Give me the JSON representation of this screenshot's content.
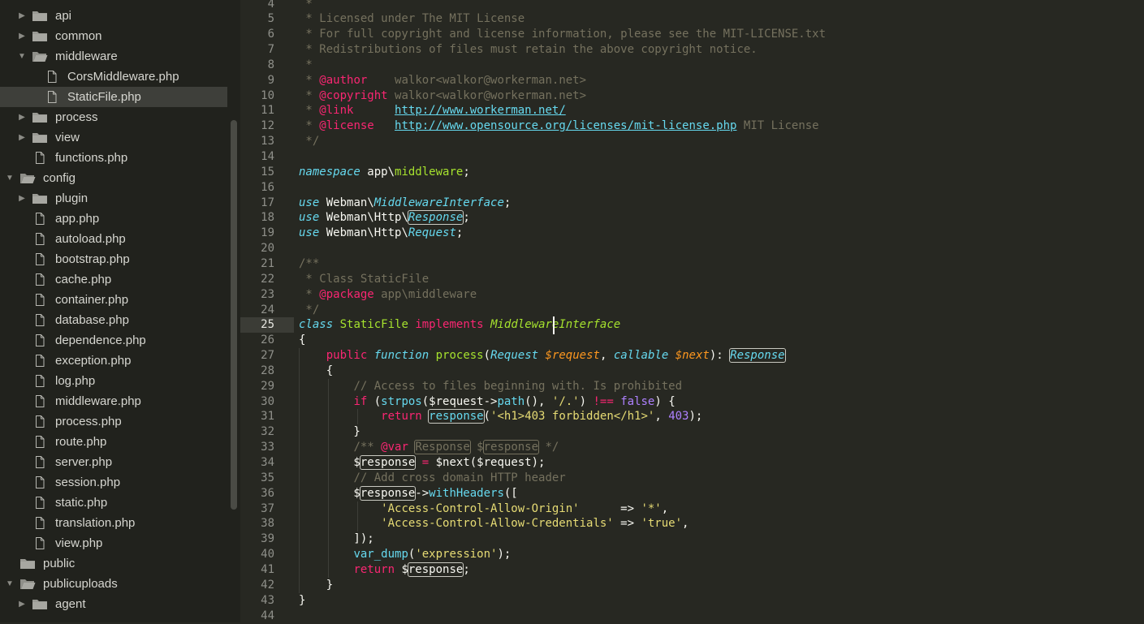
{
  "sidebar": {
    "items": [
      {
        "label": "api",
        "type": "folder",
        "state": "collapsed",
        "depth": 1
      },
      {
        "label": "common",
        "type": "folder",
        "state": "collapsed",
        "depth": 1
      },
      {
        "label": "middleware",
        "type": "folder",
        "state": "expanded",
        "depth": 1
      },
      {
        "label": "CorsMiddleware.php",
        "type": "file",
        "depth": 2
      },
      {
        "label": "StaticFile.php",
        "type": "file",
        "depth": 2,
        "selected": true
      },
      {
        "label": "process",
        "type": "folder",
        "state": "collapsed",
        "depth": 1
      },
      {
        "label": "view",
        "type": "folder",
        "state": "collapsed",
        "depth": 1
      },
      {
        "label": "functions.php",
        "type": "file",
        "depth": 1
      },
      {
        "label": "config",
        "type": "folder",
        "state": "expanded",
        "depth": 0
      },
      {
        "label": "plugin",
        "type": "folder",
        "state": "collapsed",
        "depth": 1
      },
      {
        "label": "app.php",
        "type": "file",
        "depth": 1
      },
      {
        "label": "autoload.php",
        "type": "file",
        "depth": 1
      },
      {
        "label": "bootstrap.php",
        "type": "file",
        "depth": 1
      },
      {
        "label": "cache.php",
        "type": "file",
        "depth": 1
      },
      {
        "label": "container.php",
        "type": "file",
        "depth": 1
      },
      {
        "label": "database.php",
        "type": "file",
        "depth": 1
      },
      {
        "label": "dependence.php",
        "type": "file",
        "depth": 1
      },
      {
        "label": "exception.php",
        "type": "file",
        "depth": 1
      },
      {
        "label": "log.php",
        "type": "file",
        "depth": 1
      },
      {
        "label": "middleware.php",
        "type": "file",
        "depth": 1
      },
      {
        "label": "process.php",
        "type": "file",
        "depth": 1
      },
      {
        "label": "route.php",
        "type": "file",
        "depth": 1
      },
      {
        "label": "server.php",
        "type": "file",
        "depth": 1
      },
      {
        "label": "session.php",
        "type": "file",
        "depth": 1
      },
      {
        "label": "static.php",
        "type": "file",
        "depth": 1
      },
      {
        "label": "translation.php",
        "type": "file",
        "depth": 1
      },
      {
        "label": "view.php",
        "type": "file",
        "depth": 1
      },
      {
        "label": "public",
        "type": "folder",
        "state": "none",
        "depth": 0
      },
      {
        "label": "publicuploads",
        "type": "folder",
        "state": "expanded",
        "depth": 0
      },
      {
        "label": "agent",
        "type": "folder",
        "state": "collapsed",
        "depth": 1
      }
    ]
  },
  "editor": {
    "current_line": "25",
    "lines": [
      {
        "n": "4",
        "segs": [
          {
            "t": " *",
            "c": "cm"
          }
        ]
      },
      {
        "n": "5",
        "segs": [
          {
            "t": " * Licensed under The MIT License",
            "c": "cm"
          }
        ]
      },
      {
        "n": "6",
        "segs": [
          {
            "t": " * For full copyright and license information, please see the MIT-LICENSE.txt",
            "c": "cm"
          }
        ]
      },
      {
        "n": "7",
        "segs": [
          {
            "t": " * Redistributions of files must retain the above copyright notice.",
            "c": "cm"
          }
        ]
      },
      {
        "n": "8",
        "segs": [
          {
            "t": " *",
            "c": "cm"
          }
        ]
      },
      {
        "n": "9",
        "segs": [
          {
            "t": " * ",
            "c": "cm"
          },
          {
            "t": "@author",
            "c": "tag"
          },
          {
            "t": "    walkor<walkor@workerman.net>",
            "c": "cm"
          }
        ]
      },
      {
        "n": "10",
        "segs": [
          {
            "t": " * ",
            "c": "cm"
          },
          {
            "t": "@copyright",
            "c": "tag"
          },
          {
            "t": " walkor<walkor@workerman.net>",
            "c": "cm"
          }
        ]
      },
      {
        "n": "11",
        "segs": [
          {
            "t": " * ",
            "c": "cm"
          },
          {
            "t": "@link",
            "c": "tag"
          },
          {
            "t": "      ",
            "c": "cm"
          },
          {
            "t": "http://www.workerman.net/",
            "c": "url"
          }
        ]
      },
      {
        "n": "12",
        "segs": [
          {
            "t": " * ",
            "c": "cm"
          },
          {
            "t": "@license",
            "c": "tag"
          },
          {
            "t": "   ",
            "c": "cm"
          },
          {
            "t": "http://www.opensource.org/licenses/mit-license.php",
            "c": "url"
          },
          {
            "t": " MIT License",
            "c": "cm"
          }
        ]
      },
      {
        "n": "13",
        "segs": [
          {
            "t": " */",
            "c": "cm"
          }
        ]
      },
      {
        "n": "14",
        "segs": []
      },
      {
        "n": "15",
        "segs": [
          {
            "t": "namespace",
            "c": "sk"
          },
          {
            "t": " app\\",
            "c": ""
          },
          {
            "t": "middleware",
            "c": "cls"
          },
          {
            "t": ";",
            "c": ""
          }
        ]
      },
      {
        "n": "16",
        "segs": []
      },
      {
        "n": "17",
        "segs": [
          {
            "t": "use",
            "c": "sk"
          },
          {
            "t": " Webman\\",
            "c": ""
          },
          {
            "t": "MiddlewareInterface",
            "c": "ty"
          },
          {
            "t": ";",
            "c": ""
          }
        ]
      },
      {
        "n": "18",
        "segs": [
          {
            "t": "use",
            "c": "sk"
          },
          {
            "t": " Webman\\Http\\",
            "c": ""
          },
          {
            "t": "Response",
            "c": "ty box"
          },
          {
            "t": ";",
            "c": ""
          }
        ]
      },
      {
        "n": "19",
        "segs": [
          {
            "t": "use",
            "c": "sk"
          },
          {
            "t": " Webman\\Http\\",
            "c": ""
          },
          {
            "t": "Request",
            "c": "ty"
          },
          {
            "t": ";",
            "c": ""
          }
        ]
      },
      {
        "n": "20",
        "segs": []
      },
      {
        "n": "21",
        "segs": [
          {
            "t": "/**",
            "c": "cm"
          }
        ]
      },
      {
        "n": "22",
        "segs": [
          {
            "t": " * Class StaticFile",
            "c": "cm"
          }
        ]
      },
      {
        "n": "23",
        "segs": [
          {
            "t": " * ",
            "c": "cm"
          },
          {
            "t": "@package",
            "c": "tag"
          },
          {
            "t": " app\\middleware",
            "c": "cm"
          }
        ]
      },
      {
        "n": "24",
        "segs": [
          {
            "t": " */",
            "c": "cm"
          }
        ]
      },
      {
        "n": "25",
        "segs": [
          {
            "t": "class",
            "c": "sk"
          },
          {
            "t": " ",
            "c": ""
          },
          {
            "t": "StaticFile",
            "c": "cls"
          },
          {
            "t": " ",
            "c": ""
          },
          {
            "t": "implements",
            "c": "kw"
          },
          {
            "t": " ",
            "c": ""
          },
          {
            "t": "MiddlewareInterface",
            "c": "ifc"
          }
        ]
      },
      {
        "n": "26",
        "segs": [
          {
            "t": "{",
            "c": ""
          }
        ]
      },
      {
        "n": "27",
        "segs": [
          {
            "t": "    ",
            "c": ""
          },
          {
            "t": "public",
            "c": "kw"
          },
          {
            "t": " ",
            "c": ""
          },
          {
            "t": "function",
            "c": "sk"
          },
          {
            "t": " ",
            "c": ""
          },
          {
            "t": "process",
            "c": "fn"
          },
          {
            "t": "(",
            "c": ""
          },
          {
            "t": "Request",
            "c": "ty"
          },
          {
            "t": " ",
            "c": ""
          },
          {
            "t": "$request",
            "c": "va"
          },
          {
            "t": ", ",
            "c": ""
          },
          {
            "t": "callable",
            "c": "ty"
          },
          {
            "t": " ",
            "c": ""
          },
          {
            "t": "$next",
            "c": "va"
          },
          {
            "t": "): ",
            "c": ""
          },
          {
            "t": "Response",
            "c": "ty box"
          }
        ]
      },
      {
        "n": "28",
        "segs": [
          {
            "t": "    {",
            "c": ""
          }
        ]
      },
      {
        "n": "29",
        "segs": [
          {
            "t": "        ",
            "c": ""
          },
          {
            "t": "// Access to files beginning with. Is prohibited",
            "c": "cm"
          }
        ]
      },
      {
        "n": "30",
        "segs": [
          {
            "t": "        ",
            "c": ""
          },
          {
            "t": "if",
            "c": "kw"
          },
          {
            "t": " (",
            "c": ""
          },
          {
            "t": "strpos",
            "c": "bi"
          },
          {
            "t": "($request->",
            "c": ""
          },
          {
            "t": "path",
            "c": "bi"
          },
          {
            "t": "(), ",
            "c": ""
          },
          {
            "t": "'/.'",
            "c": "st"
          },
          {
            "t": ") ",
            "c": ""
          },
          {
            "t": "!==",
            "c": "kw"
          },
          {
            "t": " ",
            "c": ""
          },
          {
            "t": "false",
            "c": "nu"
          },
          {
            "t": ") {",
            "c": ""
          }
        ]
      },
      {
        "n": "31",
        "segs": [
          {
            "t": "            ",
            "c": ""
          },
          {
            "t": "return",
            "c": "kw"
          },
          {
            "t": " ",
            "c": ""
          },
          {
            "t": "response",
            "c": "bi box"
          },
          {
            "t": "(",
            "c": ""
          },
          {
            "t": "'<h1>403 forbidden</h1>'",
            "c": "st"
          },
          {
            "t": ", ",
            "c": ""
          },
          {
            "t": "403",
            "c": "nu"
          },
          {
            "t": ");",
            "c": ""
          }
        ]
      },
      {
        "n": "32",
        "segs": [
          {
            "t": "        }",
            "c": ""
          }
        ]
      },
      {
        "n": "33",
        "segs": [
          {
            "t": "        ",
            "c": ""
          },
          {
            "t": "/** ",
            "c": "cm"
          },
          {
            "t": "@var",
            "c": "tag"
          },
          {
            "t": " ",
            "c": "cm"
          },
          {
            "t": "Response",
            "c": "cm boxd"
          },
          {
            "t": " $",
            "c": "cm"
          },
          {
            "t": "response",
            "c": "cm boxd"
          },
          {
            "t": " */",
            "c": "cm"
          }
        ]
      },
      {
        "n": "34",
        "segs": [
          {
            "t": "        $",
            "c": ""
          },
          {
            "t": "response",
            "c": "box"
          },
          {
            "t": " ",
            "c": ""
          },
          {
            "t": "=",
            "c": "kw"
          },
          {
            "t": " $next($request);",
            "c": ""
          }
        ]
      },
      {
        "n": "35",
        "segs": [
          {
            "t": "        ",
            "c": ""
          },
          {
            "t": "// Add cross domain HTTP header",
            "c": "cm"
          }
        ]
      },
      {
        "n": "36",
        "segs": [
          {
            "t": "        $",
            "c": ""
          },
          {
            "t": "response",
            "c": "box"
          },
          {
            "t": "->",
            "c": ""
          },
          {
            "t": "withHeaders",
            "c": "bi"
          },
          {
            "t": "([",
            "c": ""
          }
        ]
      },
      {
        "n": "37",
        "segs": [
          {
            "t": "            ",
            "c": ""
          },
          {
            "t": "'Access-Control-Allow-Origin'",
            "c": "st"
          },
          {
            "t": "      => ",
            "c": ""
          },
          {
            "t": "'*'",
            "c": "st"
          },
          {
            "t": ",",
            "c": ""
          }
        ]
      },
      {
        "n": "38",
        "segs": [
          {
            "t": "            ",
            "c": ""
          },
          {
            "t": "'Access-Control-Allow-Credentials'",
            "c": "st"
          },
          {
            "t": " => ",
            "c": ""
          },
          {
            "t": "'true'",
            "c": "st"
          },
          {
            "t": ",",
            "c": ""
          }
        ]
      },
      {
        "n": "39",
        "segs": [
          {
            "t": "        ]);",
            "c": ""
          }
        ]
      },
      {
        "n": "40",
        "segs": [
          {
            "t": "        ",
            "c": ""
          },
          {
            "t": "var_dump",
            "c": "bi"
          },
          {
            "t": "(",
            "c": ""
          },
          {
            "t": "'expression'",
            "c": "st"
          },
          {
            "t": ");",
            "c": ""
          }
        ]
      },
      {
        "n": "41",
        "segs": [
          {
            "t": "        ",
            "c": ""
          },
          {
            "t": "return",
            "c": "kw"
          },
          {
            "t": " $",
            "c": ""
          },
          {
            "t": "response",
            "c": "box"
          },
          {
            "t": ";",
            "c": ""
          }
        ]
      },
      {
        "n": "42",
        "segs": [
          {
            "t": "    }",
            "c": ""
          }
        ]
      },
      {
        "n": "43",
        "segs": [
          {
            "t": "}",
            "c": ""
          }
        ]
      },
      {
        "n": "44",
        "segs": []
      }
    ]
  },
  "colors": {
    "editor_bg": "#272822",
    "sidebar_bg": "#21221d",
    "selected_row": "#3e3f3a"
  },
  "icons": {
    "folder": "folder-icon",
    "folder_open": "folder-open-icon",
    "file": "file-icon",
    "arrow_right": "chevron-right-icon",
    "arrow_down": "chevron-down-icon"
  }
}
